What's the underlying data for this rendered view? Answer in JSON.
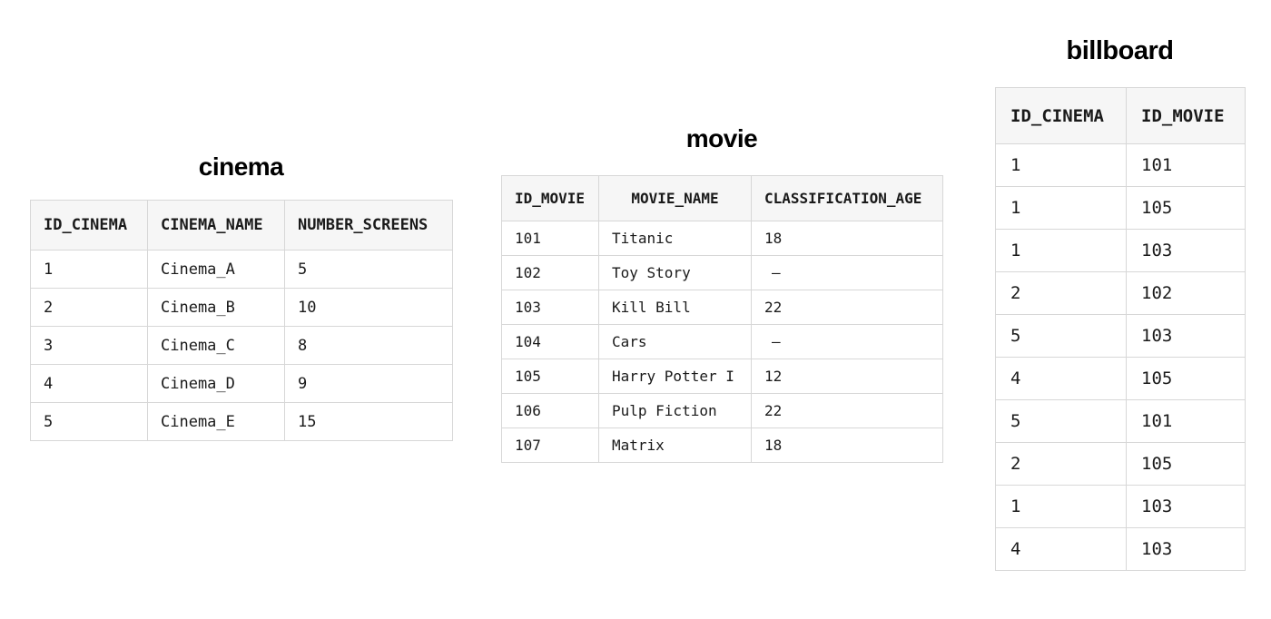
{
  "cinema": {
    "title": "cinema",
    "headers": [
      "ID_CINEMA",
      "CINEMA_NAME",
      "NUMBER_SCREENS"
    ],
    "rows": [
      [
        "1",
        "Cinema_A",
        "5"
      ],
      [
        "2",
        "Cinema_B",
        "10"
      ],
      [
        "3",
        "Cinema_C",
        "8"
      ],
      [
        "4",
        "Cinema_D",
        "9"
      ],
      [
        "5",
        "Cinema_E",
        "15"
      ]
    ]
  },
  "movie": {
    "title": "movie",
    "headers": [
      "ID_MOVIE",
      "MOVIE_NAME",
      "CLASSIFICATION_AGE"
    ],
    "rows": [
      [
        "101",
        "Titanic",
        "18"
      ],
      [
        "102",
        "Toy Story",
        "–"
      ],
      [
        "103",
        "Kill Bill",
        "22"
      ],
      [
        "104",
        "Cars",
        "–"
      ],
      [
        "105",
        "Harry Potter I",
        "12"
      ],
      [
        "106",
        "Pulp Fiction",
        "22"
      ],
      [
        "107",
        "Matrix",
        "18"
      ]
    ]
  },
  "billboard": {
    "title": "billboard",
    "headers": [
      "ID_CINEMA",
      "ID_MOVIE"
    ],
    "rows": [
      [
        "1",
        "101"
      ],
      [
        "1",
        "105"
      ],
      [
        "1",
        "103"
      ],
      [
        "2",
        "102"
      ],
      [
        "5",
        "103"
      ],
      [
        "4",
        "105"
      ],
      [
        "5",
        "101"
      ],
      [
        "2",
        "105"
      ],
      [
        "1",
        "103"
      ],
      [
        "4",
        "103"
      ]
    ]
  }
}
